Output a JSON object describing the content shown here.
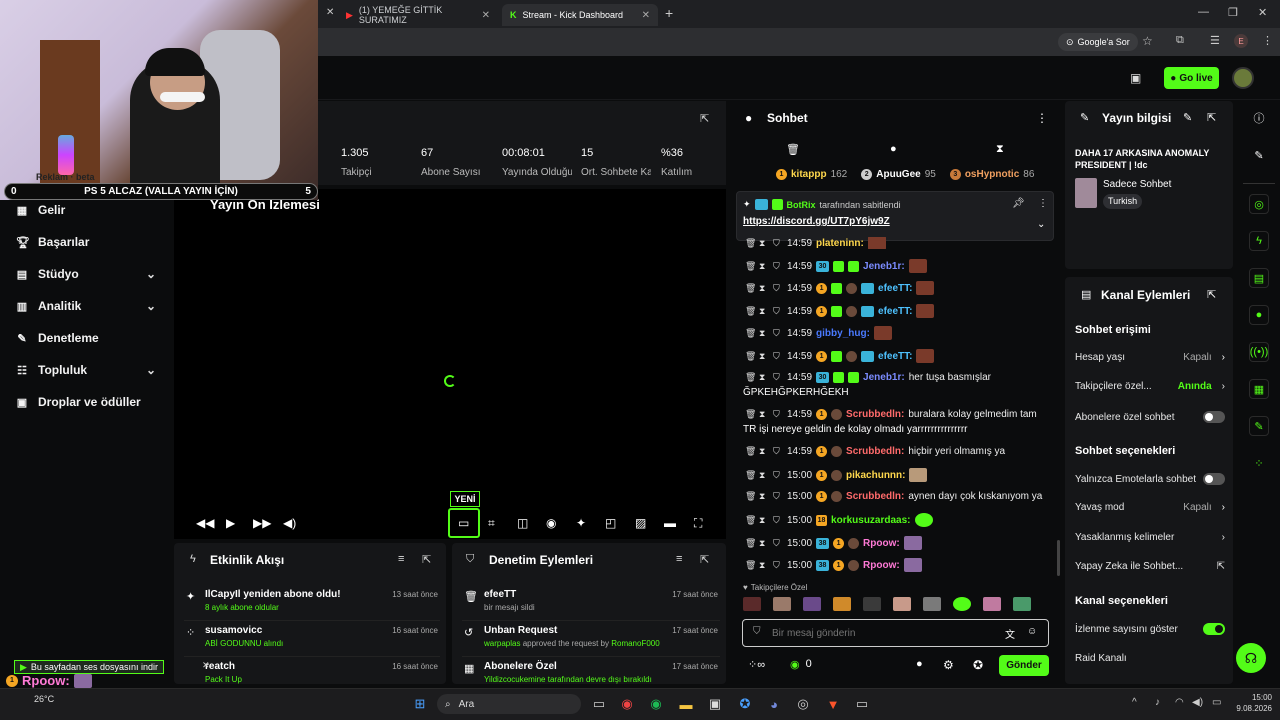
{
  "browser": {
    "tabs": [
      {
        "label": "(1) YEMEĞE GİTTİK SURATIMIZ"
      },
      {
        "label": "Stream - Kick Dashboard"
      }
    ],
    "addressbar_action": "Google'a Sor",
    "profile_initial": "E"
  },
  "header": {
    "go_live": "Go live"
  },
  "overlay": {
    "banner_left": "0",
    "banner_title": "PS 5 ALCAZ (VALLA YAYIN İÇİN)",
    "banner_right": "5",
    "hidden_nav_text": "Reklam · beta"
  },
  "stats": [
    {
      "value": "1.305",
      "label": "Takipçi"
    },
    {
      "value": "67",
      "label": "Abone Sayısı"
    },
    {
      "value": "00:08:01",
      "label": "Yayında Olduğu Süre"
    },
    {
      "value": "15",
      "label": "Ort. Sohbete Katılanlar"
    },
    {
      "value": "%36",
      "label": "Katılım"
    }
  ],
  "sidebar": {
    "items": [
      {
        "label": "Gelir",
        "icon": "dollar-icon"
      },
      {
        "label": "Başarılar",
        "icon": "trophy-icon"
      },
      {
        "label": "Stüdyo",
        "icon": "studio-icon"
      },
      {
        "label": "Analitik",
        "icon": "chart-icon"
      },
      {
        "label": "Denetleme",
        "icon": "wrench-icon"
      },
      {
        "label": "Topluluk",
        "icon": "community-icon"
      },
      {
        "label": "Droplar ve ödüller",
        "icon": "gift-icon"
      }
    ]
  },
  "preview": {
    "title": "Yayın Ön İzlemesi",
    "new_badge": "YENİ"
  },
  "activity": {
    "title": "Etkinlik Akışı",
    "items": [
      {
        "name": "IlCapyIl yeniden abone oldu!",
        "sub": "8 aylık abone oldular",
        "time": "13 saat önce"
      },
      {
        "name": "susamovicc",
        "sub": "ABİ GODUNNU alındı",
        "time": "16 saat önce"
      },
      {
        "name": "reatch",
        "sub": "Pack It Up",
        "time": "16 saat önce"
      }
    ]
  },
  "moderation": {
    "title": "Denetim Eylemleri",
    "items": [
      {
        "name": "efeeTT",
        "sub": "bir mesajı sildi",
        "time": "17 saat önce"
      },
      {
        "name": "Unban Request",
        "sub_user": "warpaplas",
        "sub": "approved the request by",
        "sub_target": "RomanoF000",
        "time": "17 saat önce"
      },
      {
        "name": "Abonelere Özel",
        "sub": "Yildizcocukemine tarafından devre dışı bırakıldı",
        "time": "17 saat önce"
      }
    ]
  },
  "chat": {
    "title": "Sohbet",
    "leaderboard": [
      {
        "rank": "1",
        "name": "kitappp",
        "score": "162"
      },
      {
        "rank": "2",
        "name": "ApuuGee",
        "score": "95"
      },
      {
        "rank": "3",
        "name": "osHypnotic",
        "score": "86"
      }
    ],
    "pinned_by": "BotRix",
    "pinned_label": "tarafından sabitlendi",
    "pinned_link": "https://discord.gg/UT7pY6jw9Z",
    "messages": [
      {
        "time": "14:59",
        "user": "plateninn:",
        "text": ""
      },
      {
        "time": "14:59",
        "user": "Jeneb1r:",
        "text": ""
      },
      {
        "time": "14:59",
        "user": "efeeTT:",
        "text": ""
      },
      {
        "time": "14:59",
        "user": "efeeTT:",
        "text": ""
      },
      {
        "time": "14:59",
        "user": "gibby_hug:",
        "text": ""
      },
      {
        "time": "14:59",
        "user": "efeeTT:",
        "text": ""
      },
      {
        "time": "14:59",
        "user": "Jeneb1r:",
        "text": "her tuşa basmışlar",
        "cont": "ĞPKEHĞPKERHĞEKH"
      },
      {
        "time": "14:59",
        "user": "Scrubbedln:",
        "text": "buralara kolay gelmedim tam",
        "cont": "TR işi nereye geldin de kolay olmadı yarrrrrrrrrrrrrrr"
      },
      {
        "time": "14:59",
        "user": "Scrubbedln:",
        "text": "hiçbir yeri olmamış ya"
      },
      {
        "time": "15:00",
        "user": "pikachunnn:",
        "text": ""
      },
      {
        "time": "15:00",
        "user": "Scrubbedln:",
        "text": "aynen dayı çok kıskanıyom ya"
      },
      {
        "time": "15:00",
        "user": "korkusuzardaas:",
        "text": "",
        "badge": "18"
      },
      {
        "time": "15:00",
        "user": "Rpoow:",
        "text": "",
        "badge": "38"
      },
      {
        "time": "15:00",
        "user": "Rpoow:",
        "text": "",
        "badge": "38"
      }
    ],
    "followers_only": "Takipçilere Özel",
    "input_placeholder": "Bir mesaj gönderin",
    "points": "0",
    "send": "Gönder"
  },
  "stream_info": {
    "title": "Yayın bilgisi",
    "stream_title": "DAHA 17 ARKASINA ANOMALY PRESIDENT | !dc",
    "category": "Sadece Sohbet",
    "language": "Turkish"
  },
  "channel_actions": {
    "title": "Kanal Eylemleri",
    "chat_access": "Sohbet erişimi",
    "account_age": {
      "label": "Hesap yaşı",
      "value": "Kapalı"
    },
    "followers_only": {
      "label": "Takipçilere özel...",
      "value": "Anında"
    },
    "subs_only": {
      "label": "Abonelere özel sohbet",
      "on": false
    },
    "chat_options": "Sohbet seçenekleri",
    "emote_only": {
      "label": "Yalnızca Emotelarla sohbet",
      "on": false
    },
    "slow_mode": {
      "label": "Yavaş mod",
      "value": "Kapalı"
    },
    "banned_words": {
      "label": "Yasaklanmış kelimeler"
    },
    "ai_chat": {
      "label": "Yapay Zeka ile Sohbet..."
    },
    "channel_options": "Kanal seçenekleri",
    "view_count": {
      "label": "İzlenme sayısını göster",
      "on": true
    },
    "raid": {
      "label": "Raid Kanalı"
    }
  },
  "notification": {
    "text": "Bu sayfadan ses dosyasını indir",
    "user": "Rpoow:"
  },
  "taskbar": {
    "weather_temp": "26°C",
    "search": "Ara",
    "time": "15:00",
    "date": "9.08.2026"
  }
}
